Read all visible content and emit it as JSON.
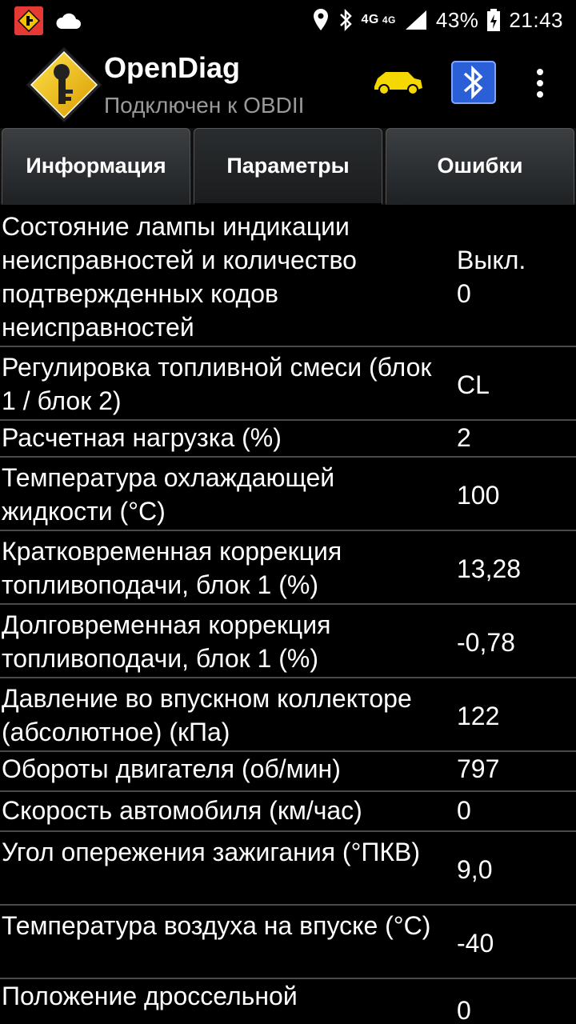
{
  "status_bar": {
    "battery": "43%",
    "time": "21:43",
    "network_a": "4G",
    "network_b": "4G"
  },
  "app": {
    "title": "OpenDiag",
    "subtitle": "Подключен к OBDII"
  },
  "colors": {
    "background": "#000000",
    "car_icon": "#f5d800",
    "logo_yellow": "#f5c400",
    "bluetooth_blue": "#2a5fd8",
    "subtitle_gray": "#9a9a9a",
    "divider": "#4a4a4a"
  },
  "tabs": [
    {
      "label": "Информация"
    },
    {
      "label": "Параметры"
    },
    {
      "label": "Ошибки"
    }
  ],
  "params": [
    {
      "name": "Состояние лампы индикации неисправностей и количество подтвержденных кодов неисправностей",
      "value": "Выкл.\n0"
    },
    {
      "name": "Регулировка топливной смеси (блок 1 / блок 2)",
      "value": "CL"
    },
    {
      "name": "Расчетная нагрузка (%)",
      "value": "2"
    },
    {
      "name": "Температура охлаждающей жидкости (°С)",
      "value": "100"
    },
    {
      "name": "Кратковременная коррекция топливоподачи, блок 1 (%)",
      "value": "13,28"
    },
    {
      "name": "Долговременная коррекция топливоподачи, блок 1 (%)",
      "value": "-0,78"
    },
    {
      "name": "Давление во впускном коллекторе (абсолютное) (кПа)",
      "value": "122"
    },
    {
      "name": "Обороты двигателя (об/мин)",
      "value": "797"
    },
    {
      "name": "Скорость автомобиля (км/час)",
      "value": "0"
    },
    {
      "name": "Угол опережения зажигания (°ПКВ)",
      "value": "9,0"
    },
    {
      "name": "Температура воздуха на впуске (°С)",
      "value": "-40"
    },
    {
      "name": "Положение дроссельной",
      "value": "0"
    }
  ]
}
